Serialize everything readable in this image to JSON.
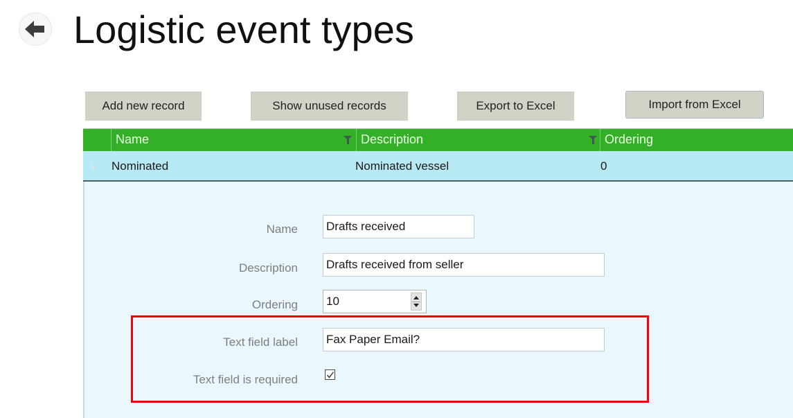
{
  "header": {
    "title": "Logistic event types",
    "back_icon": "arrow-left-icon"
  },
  "toolbar": {
    "add_label": "Add new record",
    "show_unused_label": "Show unused records",
    "export_label": "Export to Excel",
    "import_label": "Import from Excel"
  },
  "grid": {
    "columns": [
      {
        "label": "Name",
        "filter_icon": "filter-icon"
      },
      {
        "label": "Description",
        "filter_icon": "filter-icon"
      },
      {
        "label": "Ordering"
      }
    ],
    "rows": [
      {
        "name": "Nominated",
        "description": "Nominated vessel",
        "ordering": "0"
      }
    ],
    "header_color": "#33b028",
    "selected_row_color": "#b8eaf5"
  },
  "detail": {
    "name_label": "Name",
    "name_value": "Drafts received",
    "description_label": "Description",
    "description_value": "Drafts received from seller",
    "ordering_label": "Ordering",
    "ordering_value": "10",
    "text_field_label_label": "Text field label",
    "text_field_label_value": "Fax Paper Email?",
    "text_field_required_label": "Text field is required",
    "text_field_required_checked": true,
    "highlight_color": "#f2000c"
  }
}
